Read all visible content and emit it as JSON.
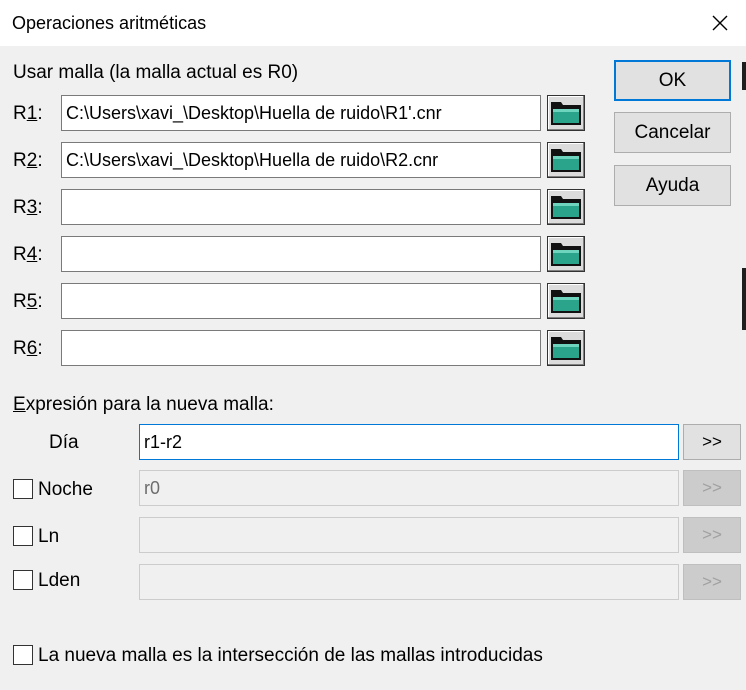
{
  "window": {
    "title": "Operaciones aritméticas"
  },
  "grids": {
    "section_label": "Usar malla (la malla actual es R0)",
    "rows": [
      {
        "pre": "R",
        "key": "1",
        "post": ":",
        "value": "C:\\Users\\xavi_\\Desktop\\Huella de ruido\\R1'.cnr"
      },
      {
        "pre": "R",
        "key": "2",
        "post": ":",
        "value": "C:\\Users\\xavi_\\Desktop\\Huella de ruido\\R2.cnr"
      },
      {
        "pre": "R",
        "key": "3",
        "post": ":",
        "value": ""
      },
      {
        "pre": "R",
        "key": "4",
        "post": ":",
        "value": ""
      },
      {
        "pre": "R",
        "key": "5",
        "post": ":",
        "value": ""
      },
      {
        "pre": "R",
        "key": "6",
        "post": ":",
        "value": ""
      }
    ]
  },
  "buttons": {
    "ok": "OK",
    "cancel": "Cancelar",
    "help": "Ayuda"
  },
  "expression": {
    "section_key": "E",
    "section_rest": "xpresión para la nueva malla:",
    "dia": {
      "label": "Día",
      "value": "r1-r2",
      "button": ">>"
    },
    "noche": {
      "label": "Noche",
      "value": "r0",
      "button": ">>"
    },
    "ln": {
      "label": "Ln",
      "value": "",
      "button": ">>"
    },
    "lden": {
      "label": "Lden",
      "value": "",
      "button": ">>"
    }
  },
  "intersection": {
    "label": "La nueva malla es la intersección de las mallas introducidas"
  },
  "colors": {
    "accent": "#0078d7",
    "folder": "#2aa58b"
  }
}
